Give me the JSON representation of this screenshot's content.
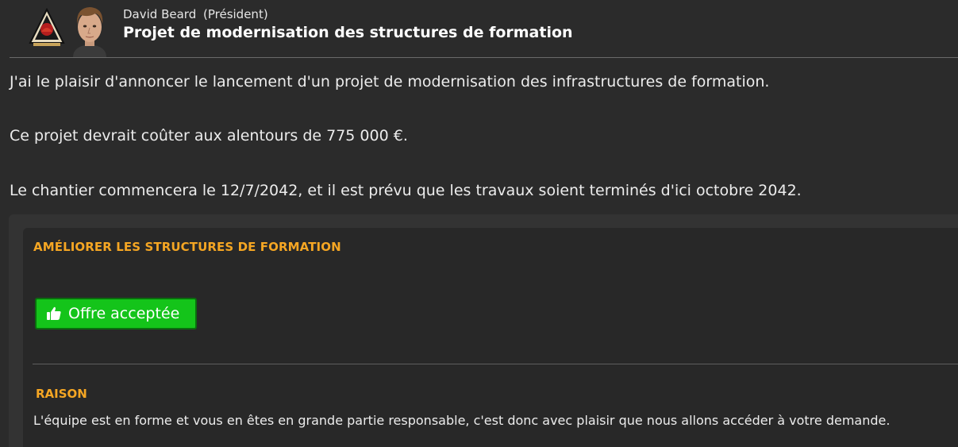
{
  "header": {
    "sender_name": "David Beard",
    "sender_role": "(Président)",
    "subject": "Projet de modernisation des structures de formation"
  },
  "message": {
    "paragraphs": [
      "J'ai le plaisir d'annoncer le lancement d'un projet de modernisation des infrastructures de formation.",
      "Ce projet devrait coûter aux alentours de 775 000 €.",
      "Le chantier commencera le 12/7/2042, et il est prévu que les travaux soient terminés d'ici octobre 2042."
    ]
  },
  "panel": {
    "title": "AMÉLIORER LES STRUCTURES DE FORMATION",
    "button_label": "Offre acceptée",
    "button_icon": "thumbs-up-icon",
    "reason_title": "RAISON",
    "reason_text": "L'équipe est en forme et vous en êtes en grande partie responsable, c'est donc avec plaisir que nous allons accéder à votre demande."
  },
  "colors": {
    "background": "#2b2b2b",
    "accent_orange": "#f5a623",
    "accept_green": "#14c41a"
  }
}
